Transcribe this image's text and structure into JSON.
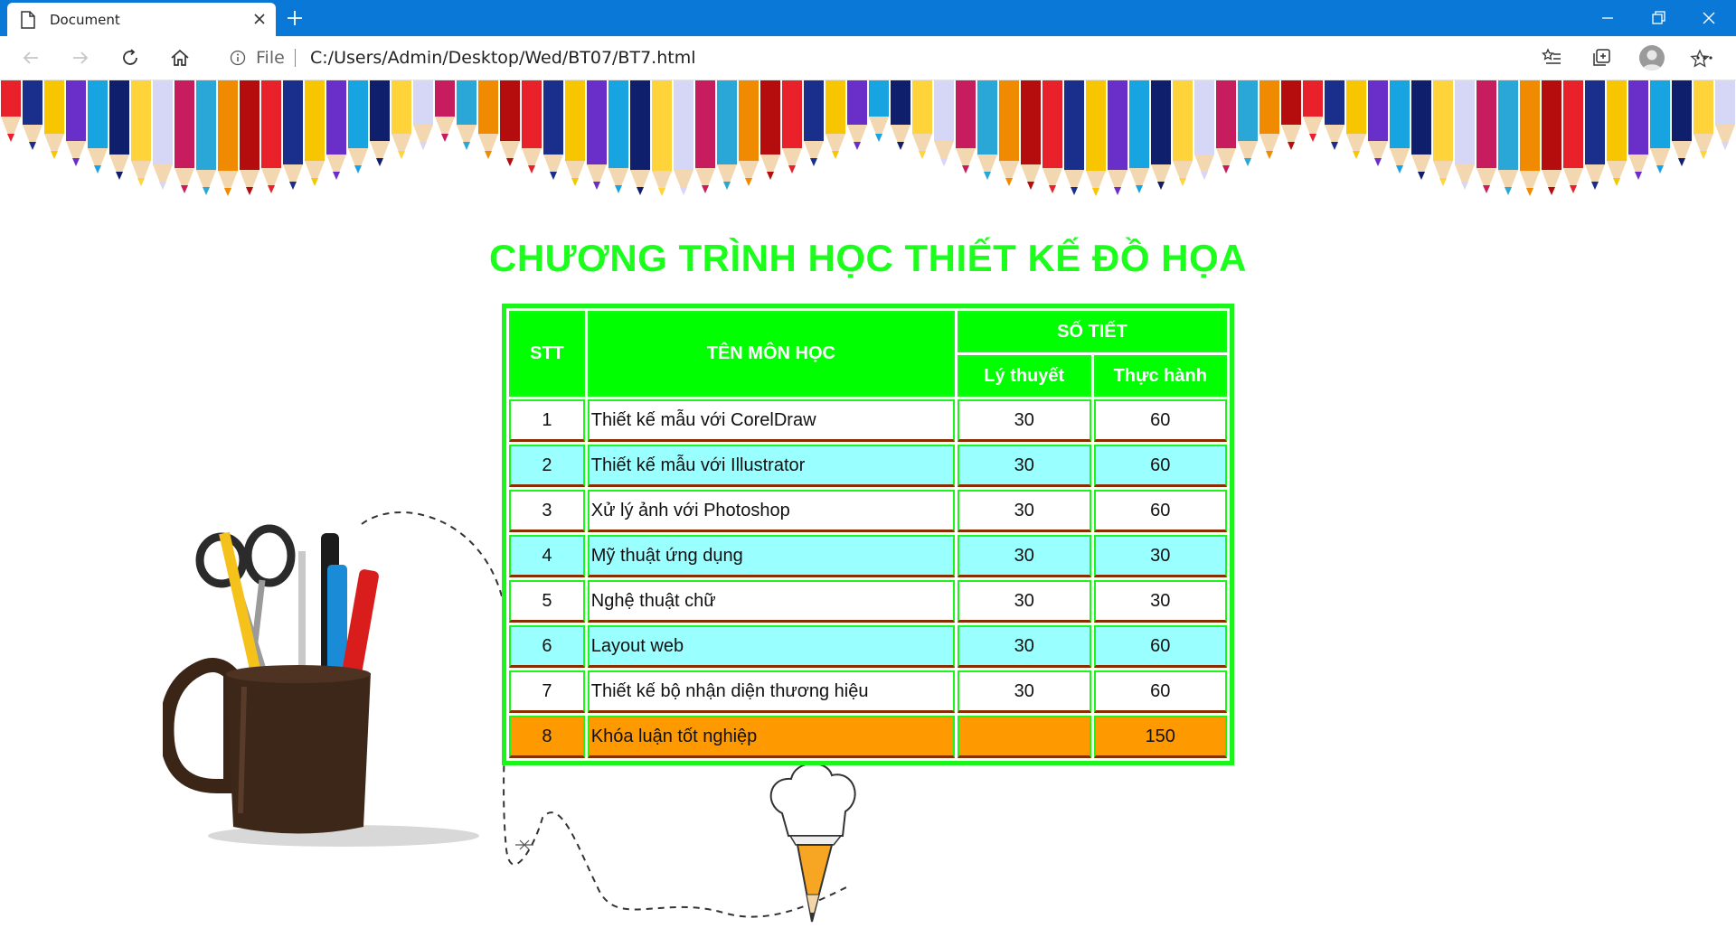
{
  "browser": {
    "tab_title": "Document",
    "url_scheme": "File",
    "url": "C:/Users/Admin/Desktop/Wed/BT07/BT7.html",
    "icons": [
      "page-icon",
      "close-icon",
      "plus-icon",
      "minimize-icon",
      "restore-icon",
      "close-window-icon",
      "back-icon",
      "forward-icon",
      "refresh-icon",
      "home-icon",
      "info-icon",
      "star-icon",
      "favorites-icon",
      "collections-icon",
      "profile-icon",
      "more-icon"
    ]
  },
  "page": {
    "title": "CHƯƠNG TRÌNH HỌC THIẾT KẾ ĐỒ HỌA",
    "table": {
      "headers": {
        "stt": "STT",
        "name": "TÊN MÔN HỌC",
        "hours": "SỐ TIẾT",
        "theory": "Lý thuyết",
        "practice": "Thực hành"
      },
      "rows": [
        {
          "stt": "1",
          "name": "Thiết kế mẫu với CorelDraw",
          "theory": "30",
          "practice": "60"
        },
        {
          "stt": "2",
          "name": "Thiết kế mẫu với Illustrator",
          "theory": "30",
          "practice": "60"
        },
        {
          "stt": "3",
          "name": "Xử lý ảnh với Photoshop",
          "theory": "30",
          "practice": "60"
        },
        {
          "stt": "4",
          "name": "Mỹ thuật ứng dụng",
          "theory": "30",
          "practice": "30"
        },
        {
          "stt": "5",
          "name": "Nghệ thuật chữ",
          "theory": "30",
          "practice": "30"
        },
        {
          "stt": "6",
          "name": "Layout web",
          "theory": "30",
          "practice": "60"
        },
        {
          "stt": "7",
          "name": "Thiết kế bộ nhận diện thương hiệu",
          "theory": "30",
          "practice": "60"
        },
        {
          "stt": "8",
          "name": "Khóa luận tốt nghiệp",
          "theory": "",
          "practice": "150"
        }
      ]
    },
    "colors": {
      "title": "#1cff1c",
      "header_bg": "#00ff00",
      "row_white": "#ffffff",
      "row_cyan": "#99ffff",
      "row_orange": "#ff9900",
      "browser_blue": "#0a78d7"
    }
  }
}
